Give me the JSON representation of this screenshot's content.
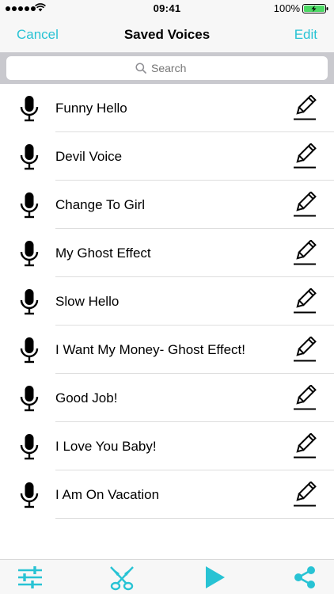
{
  "status_bar": {
    "time": "09:41",
    "battery": "100%"
  },
  "nav": {
    "cancel_label": "Cancel",
    "title": "Saved Voices",
    "edit_label": "Edit"
  },
  "search": {
    "placeholder": "Search"
  },
  "items": [
    {
      "label": "Funny Hello"
    },
    {
      "label": "Devil Voice"
    },
    {
      "label": "Change To Girl"
    },
    {
      "label": "My Ghost Effect"
    },
    {
      "label": "Slow Hello"
    },
    {
      "label": "I Want My Money- Ghost Effect!"
    },
    {
      "label": "Good Job!"
    },
    {
      "label": "I Love You Baby!"
    },
    {
      "label": "I Am On Vacation"
    }
  ],
  "toolbar": {
    "buttons": [
      {
        "icon": "sliders-icon"
      },
      {
        "icon": "scissors-icon"
      },
      {
        "icon": "play-icon"
      },
      {
        "icon": "share-icon"
      }
    ]
  },
  "colors": {
    "accent": "#28c3d4",
    "battery_fill": "#4cd964"
  }
}
